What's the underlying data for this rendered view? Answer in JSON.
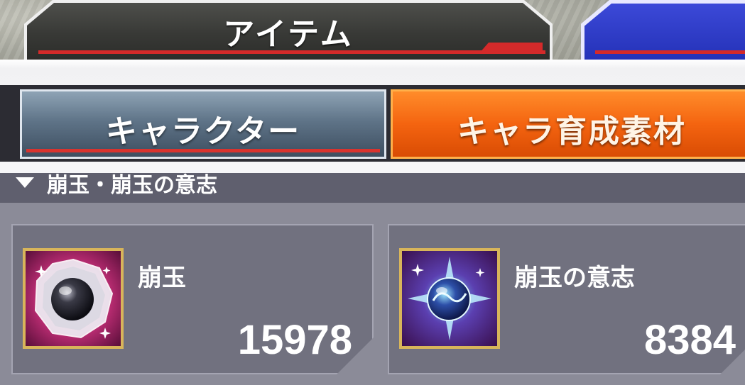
{
  "top_tabs": {
    "active": "アイテム",
    "items_label": "アイテム"
  },
  "sub_tabs": {
    "character_label": "キャラクター",
    "material_label": "キャラ育成素材"
  },
  "section": {
    "title": "崩玉・崩玉の意志"
  },
  "items": [
    {
      "name": "崩玉",
      "count": "15978",
      "icon": "hogyoku-orb-icon"
    },
    {
      "name": "崩玉の意志",
      "count": "8384",
      "icon": "hogyoku-will-orb-icon"
    }
  ],
  "colors": {
    "active_subtab": "#f46410",
    "accent_red": "#d42a2a",
    "icon_frame": "#d8b55a"
  }
}
